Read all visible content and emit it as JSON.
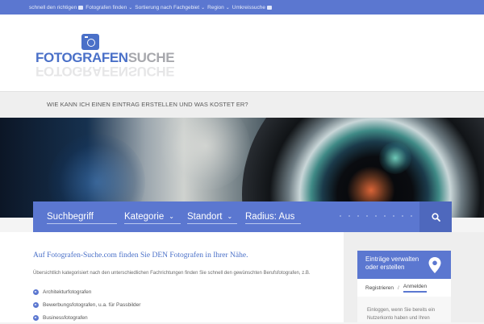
{
  "topbar": {
    "items": [
      {
        "label": "schnell den richtigen",
        "icon": "camera-icon",
        "chevron": false
      },
      {
        "label": "Fotografen finden",
        "icon": "",
        "chevron": true
      },
      {
        "label": "Sortierung nach Fachgebiet",
        "icon": "",
        "chevron": true
      },
      {
        "label": "Region",
        "icon": "",
        "chevron": true
      },
      {
        "label": "Umkreissuche",
        "icon": "camera-icon",
        "chevron": false
      }
    ]
  },
  "logo": {
    "part1": "FOTOGRAFEN",
    "part2": "SUCHE"
  },
  "question_bar": {
    "text": "WIE KANN ICH EINEN EINTRAG ERSTELLEN UND WAS KOSTET ER?"
  },
  "search": {
    "keyword_placeholder": "Suchbegriff",
    "category_label": "Kategorie",
    "location_label": "Standort",
    "radius_label": "Radius: Aus",
    "submit_icon": "search-icon"
  },
  "main": {
    "title": "Auf Fotografen-Suche.com finden Sie DEN Fotografen in Ihrer Nähe.",
    "intro": "Übersichtlich kategorisiert nach den unterschiedlichen Fachrichtungen finden Sie schnell den gewünschten Berufsfotografen, z.B.",
    "list": [
      "Architekturfotografen",
      "Bewerbungsfotografen, u.a. für Passbilder",
      "Businessfotografen"
    ]
  },
  "sidebar": {
    "widget_title_line1": "Einträge verwalten",
    "widget_title_line2": "oder erstellen",
    "tab_register": "Registrieren",
    "tab_sep": "/",
    "tab_login": "Anmelden",
    "body_line1": "Einloggen, wenn Sie bereits ein",
    "body_line2": "Nutzerkonto haben und Ihren"
  },
  "colors": {
    "accent": "#5b77d0",
    "logo_blue": "#4a70c8",
    "logo_gray": "#a7a8ad"
  }
}
